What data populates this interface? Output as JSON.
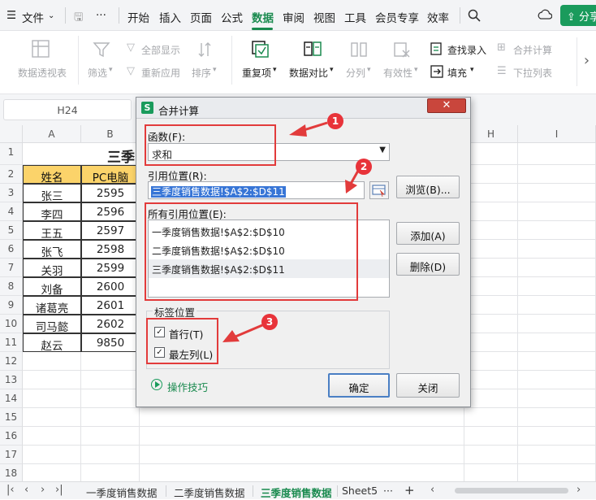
{
  "menubar": {
    "file_label": "文件",
    "tabs": [
      "开始",
      "插入",
      "页面",
      "公式",
      "数据",
      "审阅",
      "视图",
      "工具",
      "会员专享",
      "效率"
    ],
    "active_tab": "数据",
    "share_label": "分享"
  },
  "ribbon": {
    "pivot": "数据透视表",
    "filter": "筛选",
    "show_all": "全部显示",
    "reapply": "重新应用",
    "sort": "排序",
    "duplicates": "重复项",
    "compare": "数据对比",
    "split": "分列",
    "validity": "有效性",
    "lookup": "查找录入",
    "fill": "填充",
    "consolidate": "合并计算",
    "dropdown": "下拉列表"
  },
  "formula_bar": {
    "name_box": "H24"
  },
  "grid": {
    "columns": [
      "A",
      "B",
      "H",
      "I"
    ],
    "rows": [
      "1",
      "2",
      "3",
      "4",
      "5",
      "6",
      "7",
      "8",
      "9",
      "10",
      "11",
      "12",
      "13",
      "14",
      "15",
      "16",
      "17",
      "18"
    ],
    "title_text": "三季",
    "header_row": [
      "姓名",
      "PC电脑"
    ],
    "data_rows": [
      [
        "张三",
        "2595"
      ],
      [
        "李四",
        "2596"
      ],
      [
        "王五",
        "2597"
      ],
      [
        "张飞",
        "2598"
      ],
      [
        "关羽",
        "2599"
      ],
      [
        "刘备",
        "2600"
      ],
      [
        "诸葛亮",
        "2601"
      ],
      [
        "司马懿",
        "2602"
      ],
      [
        "赵云",
        "9850"
      ]
    ]
  },
  "sheet_tabs": {
    "tabs": [
      "一季度销售数据",
      "二季度销售数据",
      "三季度销售数据",
      "Sheet5"
    ],
    "active": "三季度销售数据",
    "more": "···",
    "add": "+"
  },
  "dialog": {
    "title": "合并计算",
    "close_glyph": "✕",
    "function_label": "函数(F):",
    "function_value": "求和",
    "ref_label": "引用位置(R):",
    "ref_value": "三季度销售数据!$A$2:$D$11",
    "browse_label": "浏览(B)...",
    "all_refs_label": "所有引用位置(E):",
    "all_refs": [
      "一季度销售数据!$A$2:$D$10",
      "二季度销售数据!$A$2:$D$10",
      "三季度销售数据!$A$2:$D$11"
    ],
    "add_label": "添加(A)",
    "delete_label": "删除(D)",
    "label_group": "标签位置",
    "top_row_label": "首行(T)",
    "left_col_label": "最左列(L)",
    "top_row_checked": true,
    "left_col_checked": true,
    "tips_label": "操作技巧",
    "ok_label": "确定",
    "cancel_label": "关闭"
  },
  "annotations": {
    "badges": [
      "1",
      "2",
      "3"
    ],
    "color": "#e23b3b"
  },
  "colors": {
    "accent": "#1a8a4f",
    "header_fill": "#fbd36a",
    "annotation": "#e23b3b"
  }
}
